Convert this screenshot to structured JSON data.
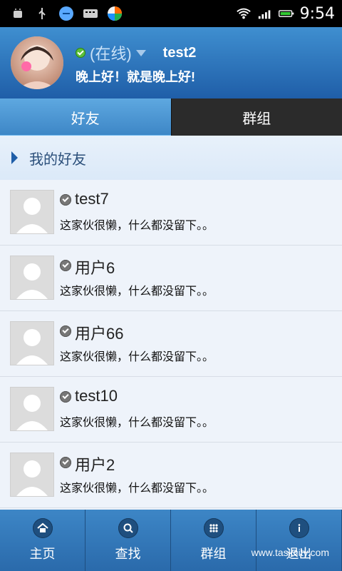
{
  "status_bar": {
    "time": "9:54",
    "icons": [
      "android-debug-icon",
      "usb-icon",
      "chat-app-icon",
      "keyboard-icon",
      "app-icon",
      "wifi-icon",
      "signal-icon",
      "battery-icon"
    ]
  },
  "header": {
    "status_text": "(在线)",
    "username": "test2",
    "signature": "晚上好！就是晚上好!"
  },
  "tabs": [
    {
      "label": "好友",
      "active": true
    },
    {
      "label": "群组",
      "active": false
    }
  ],
  "group": {
    "title": "我的好友"
  },
  "friends": [
    {
      "name": "test7",
      "signature": "这家伙很懒，什么都没留下。。"
    },
    {
      "name": "用户6",
      "signature": "这家伙很懒，什么都没留下。。"
    },
    {
      "name": "用户66",
      "signature": "这家伙很懒，什么都没留下。。"
    },
    {
      "name": "test10",
      "signature": "这家伙很懒，什么都没留下。。"
    },
    {
      "name": "用户2",
      "signature": "这家伙很懒，什么都没留下。。"
    }
  ],
  "bottom_nav": [
    {
      "label": "主页",
      "icon": "home-icon"
    },
    {
      "label": "查找",
      "icon": "search-icon"
    },
    {
      "label": "群组",
      "icon": "grid-icon"
    },
    {
      "label": "退出",
      "icon": "info-icon"
    }
  ],
  "watermark": "www.taskcity.com",
  "colors": {
    "header_blue": "#1f5ea8",
    "tab_active": "#3d86c6",
    "tab_inactive": "#2b2b2b",
    "list_bg": "#eef3fa"
  }
}
